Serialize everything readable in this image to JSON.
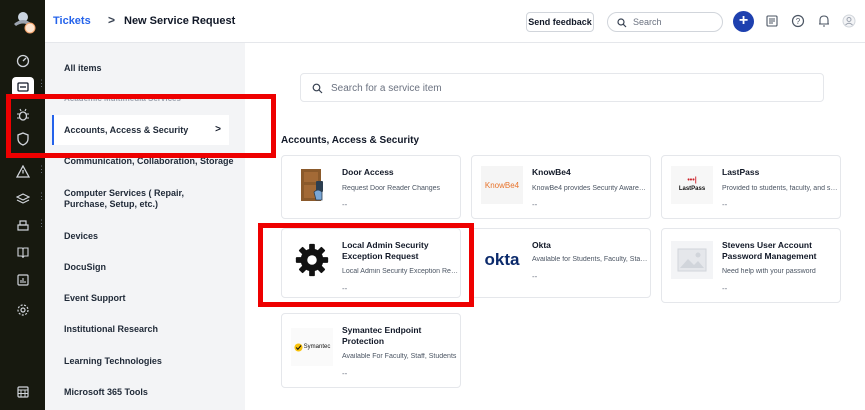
{
  "breadcrumb": {
    "root": "Tickets",
    "separator": ">",
    "current": "New Service Request"
  },
  "topbar": {
    "feedback_label": "Send feedback",
    "search_placeholder": "Search",
    "icons": [
      "plus-icon",
      "records-icon",
      "help-icon",
      "bell-icon",
      "user-icon"
    ]
  },
  "rail": {
    "icons": [
      "logo",
      "dashboard-icon",
      "tickets-icon",
      "bug-icon",
      "shield-icon",
      "alert-icon",
      "layers-icon",
      "printer-icon",
      "book-icon",
      "reports-icon",
      "settings-icon",
      "calendar-icon"
    ]
  },
  "categories": {
    "items": [
      {
        "label": "All items"
      },
      {
        "label": "Academic Multimedia Services"
      },
      {
        "label": "Accounts, Access & Security",
        "selected": true
      },
      {
        "label": "Communication, Collaboration, Storage"
      },
      {
        "label": "Computer Services ( Repair, Purchase, Setup, etc.)"
      },
      {
        "label": "Devices"
      },
      {
        "label": "DocuSign"
      },
      {
        "label": "Event Support"
      },
      {
        "label": "Institutional Research"
      },
      {
        "label": "Learning Technologies"
      },
      {
        "label": "Microsoft 365 Tools"
      }
    ],
    "selected_chevron": ">"
  },
  "main": {
    "search_placeholder": "Search for a service item",
    "section_title": "Accounts, Access & Security",
    "cards": [
      {
        "title": "Door Access",
        "desc": "Request Door Reader Changes",
        "meta": "--",
        "icon": "door-icon"
      },
      {
        "title": "KnowBe4",
        "desc": "KnowBe4 provides Security Awaren...",
        "meta": "--",
        "logo_text": "KnowBe4"
      },
      {
        "title": "LastPass",
        "desc": "Provided to students, faculty, and st...",
        "meta": "--",
        "logo_text": "LastPass",
        "logo_dots": "•••|"
      },
      {
        "title": "Local Admin Security Exception Request",
        "desc": "Local Admin Security Exception Req...",
        "meta": "--",
        "icon": "gear-icon"
      },
      {
        "title": "Okta",
        "desc": "Available for Students, Faculty, Staff...",
        "meta": "--",
        "logo_text": "okta"
      },
      {
        "title": "Stevens User Account Password Management",
        "desc": "Need help with your password",
        "meta": "--",
        "icon": "image-placeholder-icon"
      },
      {
        "title": "Symantec Endpoint Protection",
        "desc": "Available For Faculty, Staff, Students",
        "meta": "--",
        "logo_text": "Symantec"
      }
    ]
  },
  "colors": {
    "accent": "#2563eb",
    "rail": "#17190f",
    "highlight": "#ee0000",
    "plus": "#1e40af"
  }
}
